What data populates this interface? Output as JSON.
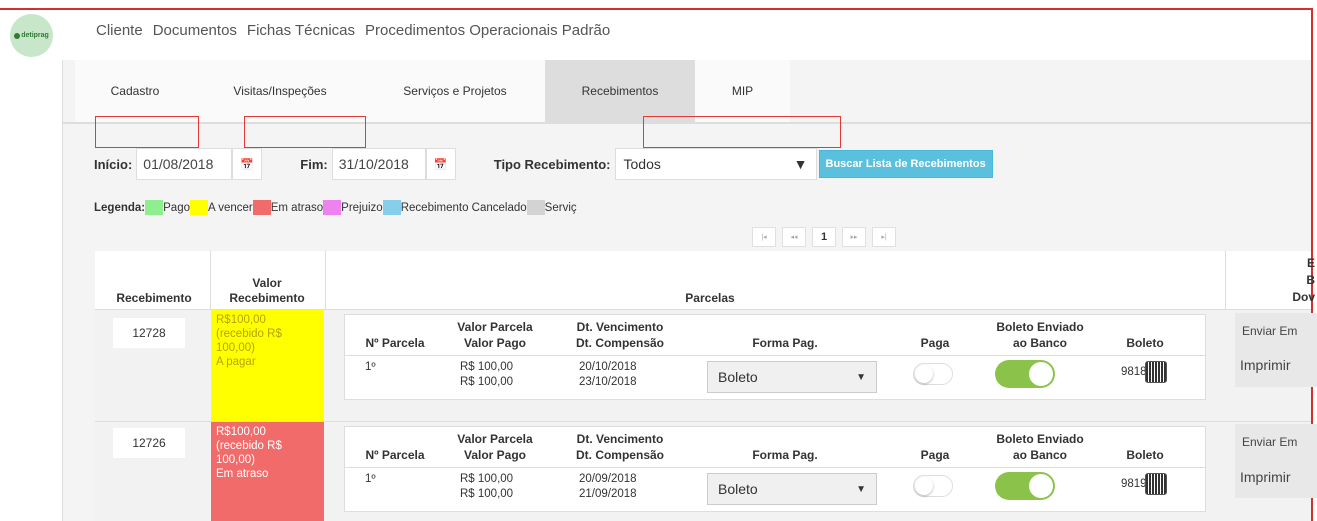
{
  "app": {
    "logo_text": "detiprag"
  },
  "topnav": [
    "Cliente",
    "Documentos",
    "Fichas Técnicas",
    "Procedimentos Operacionais Padrão"
  ],
  "tabs": [
    {
      "label": "Cadastro",
      "active": false
    },
    {
      "label": "Visitas/Inspeções",
      "active": false
    },
    {
      "label": "Serviços e Projetos",
      "active": false
    },
    {
      "label": "Recebimentos",
      "active": true
    },
    {
      "label": "MIP",
      "active": false
    }
  ],
  "filters": {
    "inicio_label": "Início:",
    "inicio_value": "01/08/2018",
    "fim_label": "Fim:",
    "fim_value": "31/10/2018",
    "tipo_label": "Tipo Recebimento:",
    "tipo_value": "Todos",
    "buscar_label": "Buscar Lista de Recebimentos"
  },
  "legend": {
    "title": "Legenda:",
    "items": [
      {
        "label": "Pago",
        "color": "#90ee90"
      },
      {
        "label": "A vencer",
        "color": "#ffff00"
      },
      {
        "label": "Em atraso",
        "color": "#f26b6b"
      },
      {
        "label": "Prejuizo",
        "color": "#ee82ee"
      },
      {
        "label": "Recebimento Cancelado",
        "color": "#87ceeb"
      },
      {
        "label": "Serviç",
        "color": "#d3d3d3"
      }
    ]
  },
  "pager": {
    "first": "|◂",
    "prev": "◂◂",
    "current": "1",
    "next": "▸▸",
    "last": "▸|"
  },
  "table": {
    "headers": {
      "recebimento": "Recebimento",
      "valor_line1": "Valor",
      "valor_line2": "Recebimento",
      "parcelas": "Parcelas",
      "extra_line1": "E",
      "extra_line2": "B",
      "extra_line3": "Dov"
    },
    "sub_headers": {
      "parcela": "Nº Parcela",
      "valor_parcela": "Valor Parcela",
      "valor_pago": "Valor Pago",
      "dt_venc": "Dt. Vencimento",
      "dt_comp": "Dt. Compensão",
      "forma": "Forma Pag.",
      "paga": "Paga",
      "boleto_env_1": "Boleto Enviado",
      "boleto_env_2": "ao Banco",
      "boleto": "Boleto"
    },
    "rows": [
      {
        "id": "12728",
        "valor_lines": [
          "R$100,00",
          "(recebido R$",
          "100,00)",
          "A pagar"
        ],
        "status_color": "#ffff00",
        "parcela": "1º",
        "valor_parcela": "R$ 100,00",
        "valor_pago": "R$ 100,00",
        "dt_venc": "20/10/2018",
        "dt_comp": "23/10/2018",
        "forma": "Boleto",
        "paga": false,
        "boleto_enviado": true,
        "boleto_num": "9818",
        "enviar": "Enviar Em",
        "imprimir": "Imprimir"
      },
      {
        "id": "12726",
        "valor_lines": [
          "R$100,00",
          "(recebido R$",
          "100,00)",
          "Em atraso"
        ],
        "status_color": "#f26b6b",
        "parcela": "1º",
        "valor_parcela": "R$ 100,00",
        "valor_pago": "R$ 100,00",
        "dt_venc": "20/09/2018",
        "dt_comp": "21/09/2018",
        "forma": "Boleto",
        "paga": false,
        "boleto_enviado": true,
        "boleto_num": "9819",
        "enviar": "Enviar Em",
        "imprimir": "Imprimir"
      }
    ]
  }
}
